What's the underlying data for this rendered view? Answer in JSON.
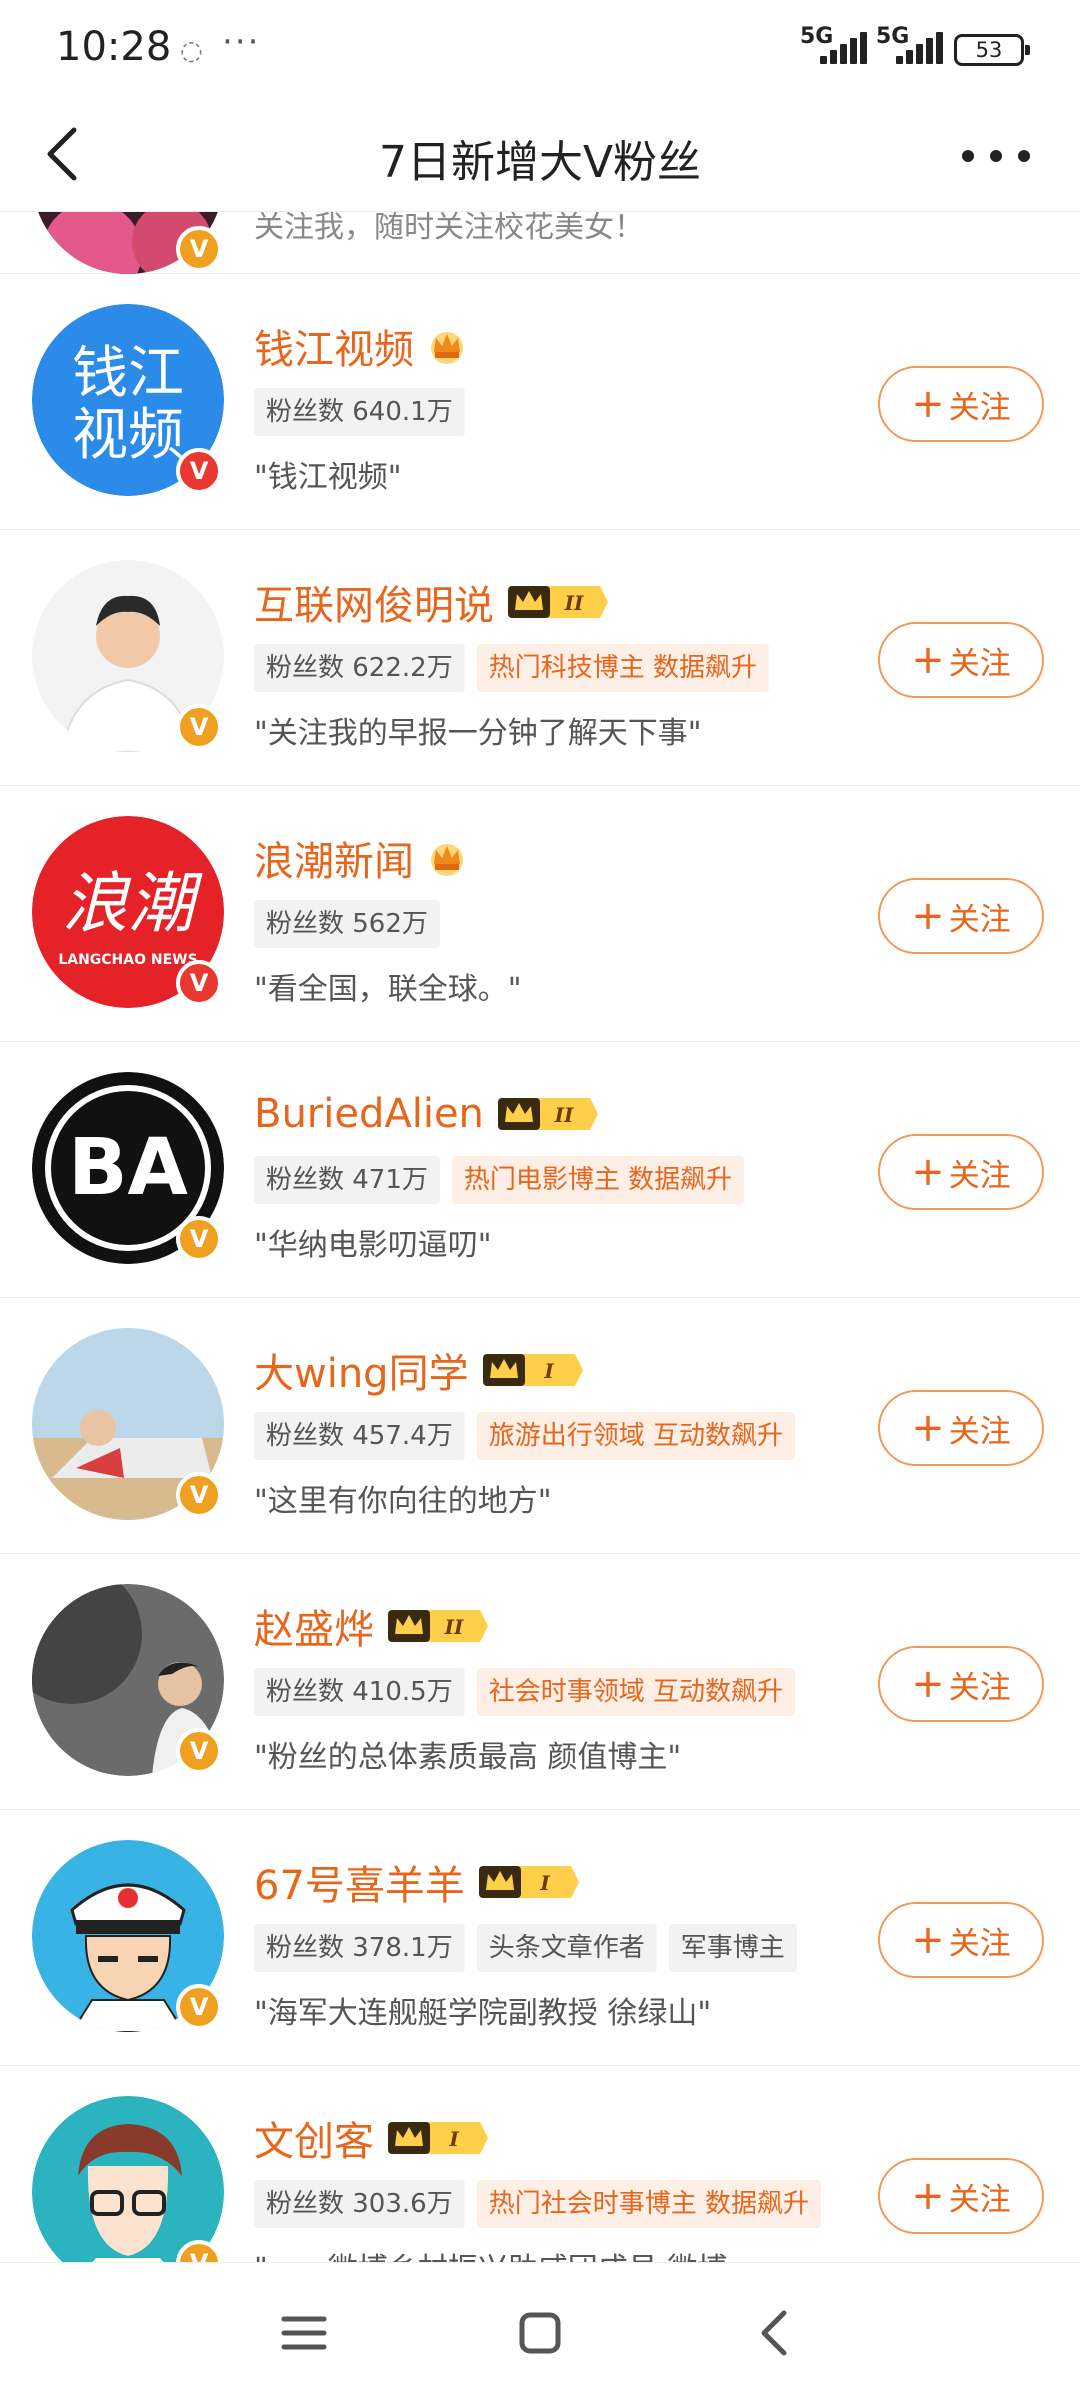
{
  "status_bar": {
    "time": "10:28",
    "network_1": "5G",
    "network_2": "5G",
    "battery": "53"
  },
  "header": {
    "title": "7日新增大V粉丝"
  },
  "partial_row": {
    "desc": "关注我，随时关注校花美女！"
  },
  "accounts": [
    {
      "name": "钱江视频",
      "level": "",
      "avatar_text": [
        "钱江",
        "视频"
      ],
      "tags": [
        {
          "text": "粉丝数 640.1万",
          "style": "grey"
        }
      ],
      "desc": "\"钱江视频\"",
      "verify_color": "red",
      "follow_label": "关注"
    },
    {
      "name": "互联网俊明说",
      "level": "II",
      "tags": [
        {
          "text": "粉丝数 622.2万",
          "style": "grey"
        },
        {
          "text": "热门科技博主 数据飙升",
          "style": "peach"
        }
      ],
      "desc": "\"关注我的早报一分钟了解天下事\"",
      "verify_color": "orange",
      "follow_label": "关注"
    },
    {
      "name": "浪潮新闻",
      "level": "",
      "avatar_text": [
        "浪潮",
        "LANGCHAO NEWS"
      ],
      "tags": [
        {
          "text": "粉丝数 562万",
          "style": "grey"
        }
      ],
      "desc": "\"看全国，联全球。\"",
      "verify_color": "red",
      "follow_label": "关注"
    },
    {
      "name": "BuriedAlien",
      "level": "II",
      "avatar_text": [
        "BA"
      ],
      "tags": [
        {
          "text": "粉丝数 471万",
          "style": "grey"
        },
        {
          "text": "热门电影博主 数据飙升",
          "style": "peach"
        }
      ],
      "desc": "\"华纳电影叨逼叨\"",
      "verify_color": "orange",
      "follow_label": "关注"
    },
    {
      "name": "大wing同学",
      "level": "I",
      "tags": [
        {
          "text": "粉丝数 457.4万",
          "style": "grey"
        },
        {
          "text": "旅游出行领域 互动数飙升",
          "style": "peach"
        }
      ],
      "desc": "\"这里有你向往的地方\"",
      "verify_color": "orange",
      "follow_label": "关注"
    },
    {
      "name": "赵盛烨",
      "level": "II",
      "tags": [
        {
          "text": "粉丝数 410.5万",
          "style": "grey"
        },
        {
          "text": "社会时事领域 互动数飙升",
          "style": "peach"
        }
      ],
      "desc": "\"粉丝的总体素质最高  颜值博主\"",
      "verify_color": "orange",
      "follow_label": "关注"
    },
    {
      "name": "67号喜羊羊",
      "level": "I",
      "tags": [
        {
          "text": "粉丝数 378.1万",
          "style": "grey"
        },
        {
          "text": "头条文章作者",
          "style": "grey"
        },
        {
          "text": "军事博主",
          "style": "grey"
        }
      ],
      "desc": "\"海军大连舰艇学院副教授 徐绿山\"",
      "verify_color": "orange",
      "follow_label": "关注"
    },
    {
      "name": "文创客",
      "level": "I",
      "tags": [
        {
          "text": "粉丝数 303.6万",
          "style": "grey"
        },
        {
          "text": "热门社会时事博主 数据飙升",
          "style": "peach"
        }
      ],
      "desc": "\"……微博乡村振兴助威团成员 微博",
      "verify_color": "orange",
      "follow_label": "关注"
    }
  ],
  "icons": {
    "back": "chevron-left-icon",
    "more": "more-dots-icon",
    "verify": "verified-v-icon",
    "crown": "crown-icon"
  },
  "colors": {
    "name": "#e8661c",
    "button_border": "#f09b5b",
    "verify_red": "#e8382f",
    "verify_orange": "#f0a020"
  }
}
